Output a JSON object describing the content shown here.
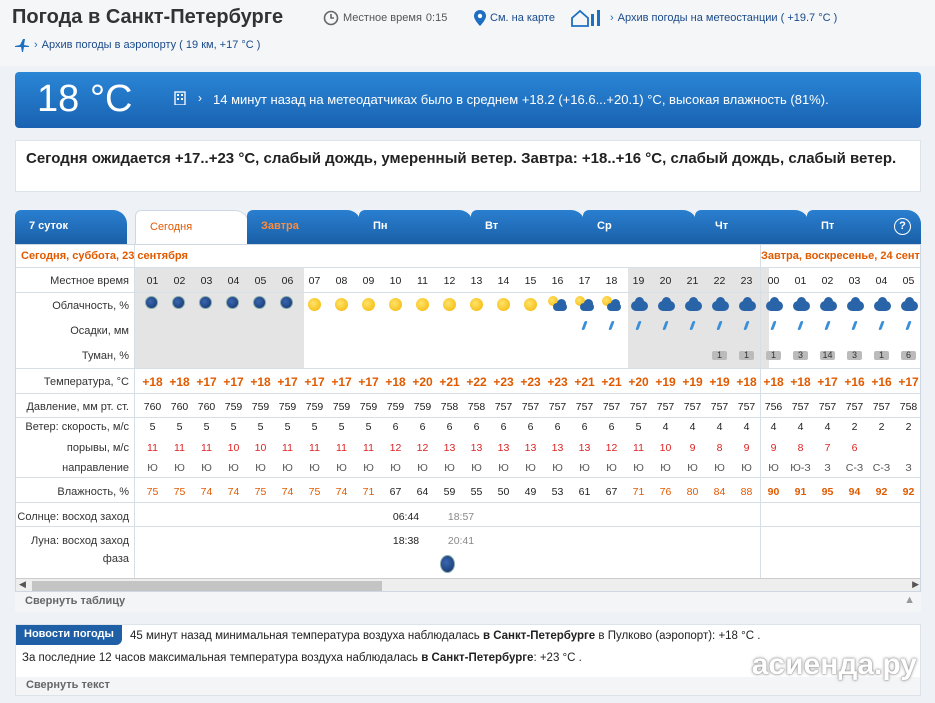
{
  "header": {
    "title": "Погода в Санкт-Петербурге",
    "local_time_label": "Местное время",
    "local_time": "0:15",
    "map_link": "См. на карте",
    "archive_station": "Архив погоды на метеостанции ( +19.7 °C )",
    "archive_airport": "Архив погоды в аэропорту ( 19 км, +17 °C )"
  },
  "now": {
    "temp": "18 °C",
    "text": "14 минут назад на метеодатчиках было в среднем +18.2 (+16.6...+20.1) °C, высокая влажность (81%)."
  },
  "forecast_text": "Сегодня ожидается +17..+23 °C, слабый дождь, умеренный ветер. Завтра: +18..+16 °C, слабый дождь, слабый ветер.",
  "tabs": [
    {
      "label": "7 суток"
    },
    {
      "label": "Сегодня"
    },
    {
      "label": "Завтра"
    },
    {
      "label": "Пн"
    },
    {
      "label": "Вт"
    },
    {
      "label": "Ср"
    },
    {
      "label": "Чт"
    },
    {
      "label": "Пт"
    }
  ],
  "help": "?",
  "table": {
    "day1": "Сегодня, суббота, 23 сентября",
    "day2": "Завтра, воскресенье, 24 сентября",
    "row_labels": {
      "time": "Местное время",
      "clouds": "Облачность, %",
      "precip": "Осадки, мм",
      "fog": "Туман, %",
      "temp": "Температура, °C",
      "pressure": "Давление, мм рт. ст.",
      "wind": "Ветер: скорость, м/с",
      "gust": "порывы, м/с",
      "dir": "направление",
      "humidity": "Влажность, %",
      "sun": "Солнце: восход заход",
      "moon": "Луна: восход заход",
      "phase": "фаза"
    },
    "hours": [
      "01",
      "02",
      "03",
      "04",
      "05",
      "06",
      "07",
      "08",
      "09",
      "10",
      "11",
      "12",
      "13",
      "14",
      "15",
      "16",
      "17",
      "18",
      "19",
      "20",
      "21",
      "22",
      "23",
      "00",
      "01",
      "02",
      "03",
      "04",
      "05"
    ],
    "cloud_icons": [
      "moon-cloud",
      "moon-cloud",
      "moon-cloud",
      "moon-cloud",
      "moon-cloud",
      "moon-cloud",
      "sun",
      "sun",
      "sun",
      "sun",
      "sun",
      "sun",
      "sun",
      "sun",
      "sun",
      "sun-cloud",
      "sun-cloud",
      "sun-cloud",
      "cloud",
      "cloud",
      "cloud",
      "cloud",
      "cloud",
      "cloud",
      "cloud",
      "cloud",
      "cloud",
      "cloud",
      "cloud"
    ],
    "rain": [
      false,
      false,
      false,
      false,
      false,
      false,
      false,
      false,
      false,
      false,
      false,
      false,
      false,
      false,
      false,
      false,
      true,
      true,
      true,
      true,
      true,
      true,
      true,
      true,
      true,
      true,
      true,
      true,
      true
    ],
    "fog": [
      "",
      "",
      "",
      "",
      "",
      "",
      "",
      "",
      "",
      "",
      "",
      "",
      "",
      "",
      "",
      "",
      "",
      "",
      "",
      "",
      "",
      "1",
      "1",
      "1",
      "3",
      "14",
      "3",
      "1",
      "6"
    ],
    "temp": [
      "+18",
      "+18",
      "+17",
      "+17",
      "+18",
      "+17",
      "+17",
      "+17",
      "+17",
      "+18",
      "+20",
      "+21",
      "+22",
      "+23",
      "+23",
      "+23",
      "+21",
      "+21",
      "+20",
      "+19",
      "+19",
      "+19",
      "+18",
      "+18",
      "+18",
      "+17",
      "+16",
      "+16",
      "+17"
    ],
    "pressure": [
      "760",
      "760",
      "760",
      "759",
      "759",
      "759",
      "759",
      "759",
      "759",
      "759",
      "759",
      "758",
      "758",
      "757",
      "757",
      "757",
      "757",
      "757",
      "757",
      "757",
      "757",
      "757",
      "757",
      "756",
      "757",
      "757",
      "757",
      "757",
      "758"
    ],
    "wind": [
      "5",
      "5",
      "5",
      "5",
      "5",
      "5",
      "5",
      "5",
      "5",
      "6",
      "6",
      "6",
      "6",
      "6",
      "6",
      "6",
      "6",
      "6",
      "5",
      "4",
      "4",
      "4",
      "4",
      "4",
      "4",
      "4",
      "2",
      "2",
      "2"
    ],
    "gust": [
      "11",
      "11",
      "11",
      "10",
      "10",
      "11",
      "11",
      "11",
      "11",
      "12",
      "12",
      "13",
      "13",
      "13",
      "13",
      "13",
      "13",
      "12",
      "11",
      "10",
      "9",
      "8",
      "9",
      "9",
      "8",
      "7",
      "6",
      "",
      ""
    ],
    "dir": [
      "Ю",
      "Ю",
      "Ю",
      "Ю",
      "Ю",
      "Ю",
      "Ю",
      "Ю",
      "Ю",
      "Ю",
      "Ю",
      "Ю",
      "Ю",
      "Ю",
      "Ю",
      "Ю",
      "Ю",
      "Ю",
      "Ю",
      "Ю",
      "Ю",
      "Ю",
      "Ю",
      "Ю",
      "Ю-З",
      "З",
      "С-З",
      "С-З",
      "З"
    ],
    "humidity": [
      "75",
      "75",
      "74",
      "74",
      "75",
      "74",
      "75",
      "74",
      "71",
      "67",
      "64",
      "59",
      "55",
      "50",
      "49",
      "53",
      "61",
      "67",
      "71",
      "76",
      "80",
      "84",
      "88",
      "90",
      "91",
      "95",
      "94",
      "92",
      "92"
    ],
    "sunrise": "06:44",
    "sunset": "18:57",
    "moonrise": "18:38",
    "moonset": "20:41"
  },
  "collapse_table": "Свернуть таблицу",
  "news": {
    "badge": "Новости погоды",
    "line1_pre": "45 минут назад минимальная температура воздуха наблюдалась ",
    "line1_bold": "в Санкт-Петербурге",
    "line1_post": " в Пулково (аэропорт): +18 °C .",
    "line2_pre": "За последние 12 часов максимальная температура воздуха наблюдалась ",
    "line2_bold": "в Санкт-Петербурге",
    "line2_post": ": +23 °C .",
    "collapse": "Свернуть текст"
  },
  "watermark": "асиенда.ру"
}
